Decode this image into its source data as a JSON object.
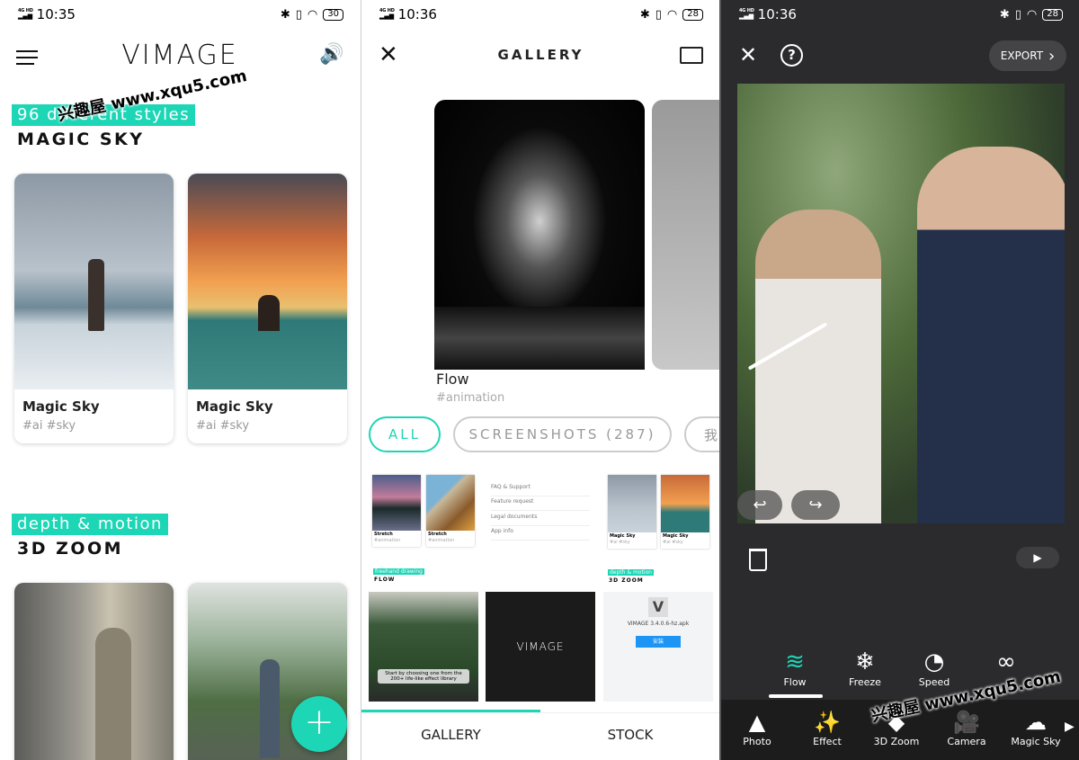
{
  "accent": "#1dd6b6",
  "watermark": "兴趣屋 www.xqu5.com",
  "home": {
    "status": {
      "time": "10:35",
      "battery": "30",
      "network": "4G HD"
    },
    "logo": "VIMAGE",
    "sections": [
      {
        "tag": "96 different styles",
        "title": "MAGIC SKY",
        "cards": [
          {
            "title": "Magic Sky",
            "tags": "#ai #sky"
          },
          {
            "title": "Magic Sky",
            "tags": "#ai #sky"
          }
        ]
      },
      {
        "tag": "depth & motion",
        "title": "3D ZOOM"
      }
    ],
    "fab_label": "+"
  },
  "gallery": {
    "status": {
      "time": "10:36",
      "battery": "28",
      "network": "4G HD"
    },
    "title": "GALLERY",
    "featured": {
      "title": "Flow",
      "tags": "#animation"
    },
    "chips": [
      "ALL",
      "SCREENSHOTS (287)",
      "我"
    ],
    "thumbs": {
      "stretch1": {
        "title": "Stretch",
        "tags": "#animation"
      },
      "stretch2": {
        "title": "Stretch",
        "tags": "#animation"
      },
      "menu": [
        "FAQ & Support",
        "Feature request",
        "Legal documents",
        "App info"
      ],
      "sky1": {
        "title": "Magic Sky",
        "tags": "#ai #sky"
      },
      "sky2": {
        "title": "Magic Sky",
        "tags": "#ai #sky"
      },
      "flow_tag": "freehand drawing",
      "flow_title": "FLOW",
      "zoom_tag": "depth & motion",
      "zoom_title": "3D ZOOM",
      "tip": "Start by choosing one from the 200+ life-like effect library",
      "logo": "VIMAGE",
      "apk": "VIMAGE 3.4.0.6-hz.apk",
      "install": "安装"
    },
    "bottom_tabs": [
      "GALLERY",
      "STOCK"
    ]
  },
  "editor": {
    "status": {
      "time": "10:36",
      "battery": "28",
      "network": "4G HD"
    },
    "export_label": "EXPORT",
    "tools": [
      {
        "label": "Flow",
        "icon": "flow-icon",
        "active": true
      },
      {
        "label": "Freeze",
        "icon": "snowflake-icon"
      },
      {
        "label": "Speed",
        "icon": "speedometer-icon"
      },
      {
        "label": "",
        "icon": "path-icon"
      }
    ],
    "nav": [
      {
        "label": "Photo",
        "icon": "photo-icon"
      },
      {
        "label": "Effect",
        "icon": "magic-wand-icon"
      },
      {
        "label": "3D Zoom",
        "icon": "3d-zoom-icon"
      },
      {
        "label": "Camera",
        "icon": "camera-icon"
      },
      {
        "label": "Magic Sky",
        "icon": "cloud-icon"
      }
    ]
  }
}
